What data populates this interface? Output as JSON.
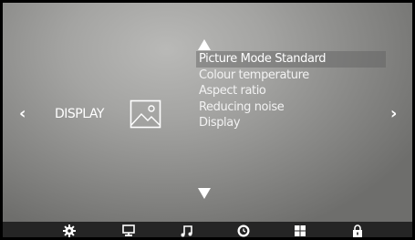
{
  "nav": {
    "prev_label": "‹",
    "next_label": "›",
    "section_title": "DISPLAY",
    "section_icon": "picture-icon",
    "up_icon": "triangle-up-icon",
    "down_icon": "triangle-down-icon"
  },
  "menu": {
    "items": [
      "Picture Mode Standard",
      "Colour temperature",
      "Aspect ratio",
      "Reducing noise",
      "Display"
    ],
    "selected_index": 0
  },
  "bottom_bar": {
    "tabs": [
      "settings-gear-icon",
      "monitor-icon",
      "music-note-icon",
      "clock-icon",
      "grid-icon",
      "lock-icon"
    ]
  },
  "colors": {
    "text": "#ffffff",
    "highlight": "#5f5f5f",
    "bar": "#252525"
  }
}
